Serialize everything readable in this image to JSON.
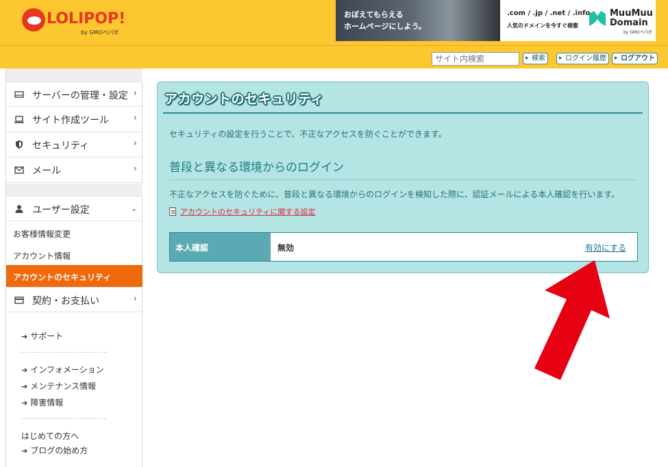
{
  "header": {
    "logo_text": "LOLIPOP!",
    "logo_sub": "by GMOペパボ",
    "banner": {
      "caption_line1": "おぼえてもらえる",
      "caption_line2": "ホームページにしよう。",
      "tlds": ".com / .jp / .net / .info",
      "tagline": "人気のドメインを今すぐ検索",
      "brand_line1": "MuuMuu",
      "brand_line2": "Domain",
      "brand_sub": "by GMOペパボ"
    },
    "search_placeholder": "サイト内検索",
    "search_button": "検索",
    "login_history_button": "ログイン履歴",
    "logout_button": "ログアウト"
  },
  "sidebar": {
    "menu": [
      {
        "label": "サーバーの管理・設定",
        "icon": "server-icon"
      },
      {
        "label": "サイト作成ツール",
        "icon": "laptop-icon"
      },
      {
        "label": "セキュリティ",
        "icon": "shield-icon"
      },
      {
        "label": "メール",
        "icon": "mail-icon"
      }
    ],
    "user_settings": {
      "label": "ユーザー設定",
      "icon": "user-icon",
      "items": [
        "お客様情報変更",
        "アカウント情報",
        "アカウントのセキュリティ"
      ],
      "active_index": 2
    },
    "billing": {
      "label": "契約・お支払い",
      "icon": "card-icon"
    },
    "links_group1": [
      "サポート"
    ],
    "links_group2": [
      "インフォメーション",
      "メンテナンス情報",
      "障害情報"
    ],
    "links_group3_plain": "はじめての方へ",
    "links_group3": [
      "ブログの始め方"
    ]
  },
  "main": {
    "title": "アカウントのセキュリティ",
    "description": "セキュリティの設定を行うことで、不正なアクセスを防ぐことができます。",
    "section_title": "普段と異なる環境からのログイン",
    "section_description": "不正なアクセスを防ぐために、普段と異なる環境からのログインを検知した際に、認証メールによる本人確認を行います。",
    "doc_link": "アカウントのセキュリティに関する設定",
    "setting": {
      "label": "本人確認",
      "value": "無効",
      "action": "有効にする"
    }
  },
  "colors": {
    "header_bg": "#fdc72f",
    "brand_red": "#e8361f",
    "active_orange": "#ee6a0c",
    "panel_bg": "#b4e4e3",
    "teal_dark": "#1e8d94",
    "annotation_arrow": "#e50012"
  }
}
